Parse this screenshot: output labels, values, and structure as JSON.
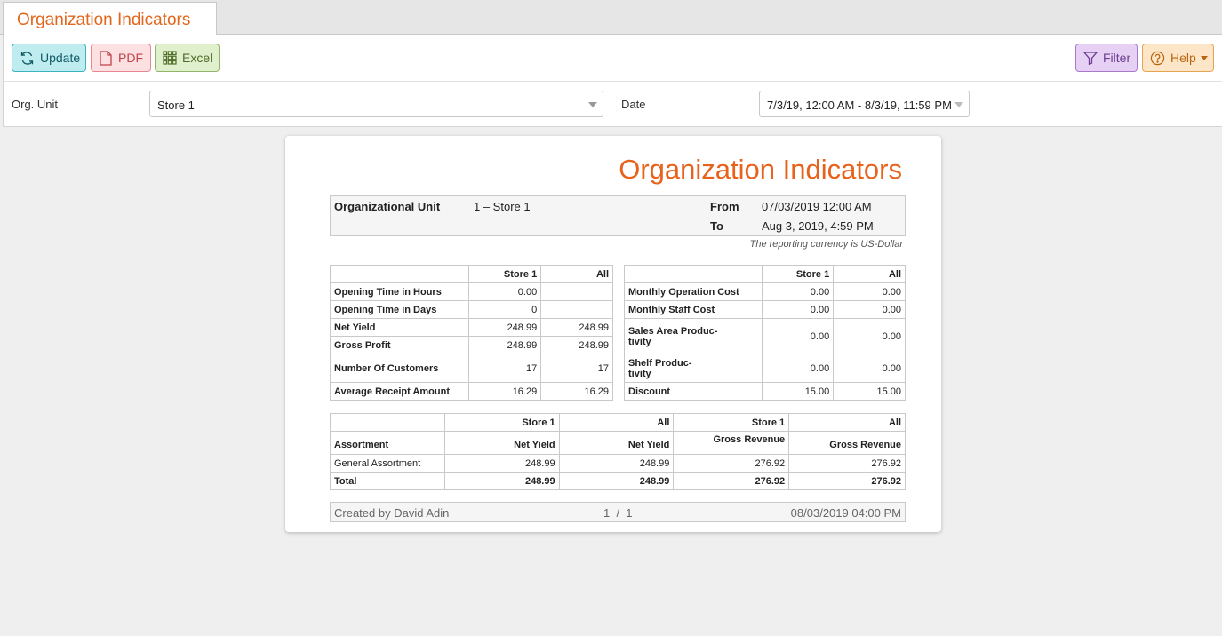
{
  "tab": {
    "title": "Organization Indicators"
  },
  "toolbar": {
    "update_label": "Update",
    "pdf_label": "PDF",
    "excel_label": "Excel",
    "filter_label": "Filter",
    "help_label": "Help"
  },
  "params": {
    "org_unit_label": "Org. Unit",
    "org_unit_value": "Store 1",
    "date_label": "Date",
    "date_value": "7/3/19, 12:00 AM - 8/3/19, 11:59 PM"
  },
  "report": {
    "title": "Organization Indicators",
    "info": {
      "org_unit_key": "Organizational Unit",
      "org_unit_val": "1 – Store 1",
      "from_key": "From",
      "from_val": "07/03/2019 12:00 AM",
      "to_key": "To",
      "to_val": "Aug 3, 2019, 4:59 PM"
    },
    "currency_note": "The reporting currency is US-Dollar",
    "left_table": {
      "headers": [
        "Store 1",
        "All"
      ],
      "rows": [
        {
          "label": "Opening Time in Hours",
          "store": "0.00",
          "all": ""
        },
        {
          "label": "Opening Time in Days",
          "store": "0",
          "all": ""
        },
        {
          "label": "Net Yield",
          "store": "248.99",
          "all": "248.99"
        },
        {
          "label": "Gross Profit",
          "store": "248.99",
          "all": "248.99"
        },
        {
          "label": "Number Of Customers",
          "store": "17",
          "all": "17"
        },
        {
          "label": "Average Receipt Amount",
          "store": "16.29",
          "all": "16.29"
        }
      ]
    },
    "right_table": {
      "headers": [
        "Store 1",
        "All"
      ],
      "rows": [
        {
          "label": "Monthly Operation Cost",
          "store": "0.00",
          "all": "0.00"
        },
        {
          "label": "Monthly Staff Cost",
          "store": "0.00",
          "all": "0.00"
        },
        {
          "label1": "Sales Area Produc-",
          "label2": "tivity",
          "store": "0.00",
          "all": "0.00"
        },
        {
          "label1": "Shelf Produc-",
          "label2": "tivity",
          "store": "0.00",
          "all": "0.00"
        },
        {
          "label": "Discount",
          "store": "15.00",
          "all": "15.00"
        }
      ]
    },
    "assortment_table": {
      "group_headers": [
        "Store 1",
        "All",
        "Store 1",
        "All"
      ],
      "col_headers": [
        "Assortment",
        "Net Yield",
        "Net Yield",
        "Gross Revenue",
        "Gross Revenue"
      ],
      "rows": [
        {
          "cells": [
            "General Assortment",
            "248.99",
            "248.99",
            "276.92",
            "276.92"
          ]
        }
      ],
      "total": [
        "Total",
        "248.99",
        "248.99",
        "276.92",
        "276.92"
      ]
    },
    "footer": {
      "created_by": "Created by David Adin",
      "page": "1  /  1",
      "timestamp": "08/03/2019 04:00 PM"
    }
  }
}
